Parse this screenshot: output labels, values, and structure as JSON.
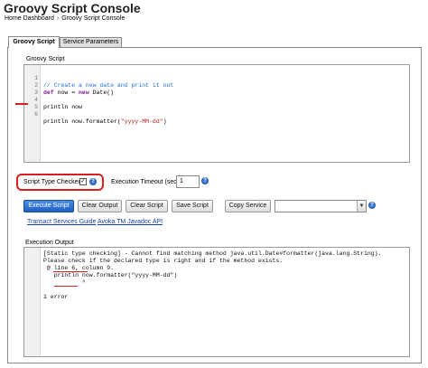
{
  "header": {
    "title": "Groovy Script Console",
    "breadcrumb": [
      "Home Dashboard",
      "Groovy Script Console"
    ],
    "breadcrumb_separator": "›"
  },
  "tabs": [
    {
      "label": "Groovy Script",
      "active": true
    },
    {
      "label": "Service Parameters",
      "active": false
    }
  ],
  "editor": {
    "label": "Groovy Script",
    "lines": [
      {
        "n": "1",
        "text": "// Create a new date and print it out",
        "kind": "comment"
      },
      {
        "n": "2",
        "kw": "def",
        "rest": " now = ",
        "kw2": "new",
        "rest2": " Date()",
        "kind": "code"
      },
      {
        "n": "3",
        "text": "",
        "kind": "plain"
      },
      {
        "n": "4",
        "text": "println now",
        "kind": "plain"
      },
      {
        "n": "5",
        "text": "",
        "kind": "plain"
      },
      {
        "n": "6",
        "pre": "println now.formatter(",
        "str": "\"yyyy-MM-dd\"",
        "post": ")",
        "kind": "string"
      }
    ]
  },
  "options": {
    "script_type_checked_label": "Script Type Checked",
    "script_type_checked": true,
    "checkmark": "✓",
    "execution_timeout_label": "Execution Timeout (sec)",
    "execution_timeout_value": "1",
    "help_glyph": "?"
  },
  "buttons": {
    "execute": "Execute Script",
    "clear_output": "Clear Output",
    "clear_script": "Clear Script",
    "save_script": "Save Script",
    "copy_service": "Copy Service"
  },
  "copy_service_select": {
    "selected": "",
    "arrow": "▼"
  },
  "links": {
    "transact_guide": "Transact Services Guide",
    "javadoc": "Avoka TM Javadoc API"
  },
  "output": {
    "label": "Execution Output",
    "lines": [
      "[Static type checking] - Cannot find matching method java.util.Date#formatter(java.lang.String).",
      "Please check if the declared type is right and if the method exists.",
      " @ line 6, column 9.",
      "   println now.formatter(\"yyyy-MM-dd\")",
      "           ^",
      "",
      "1 error"
    ]
  },
  "colors": {
    "accent": "#1f5fc0",
    "annotation": "#d62020",
    "link": "#1a3fae"
  }
}
